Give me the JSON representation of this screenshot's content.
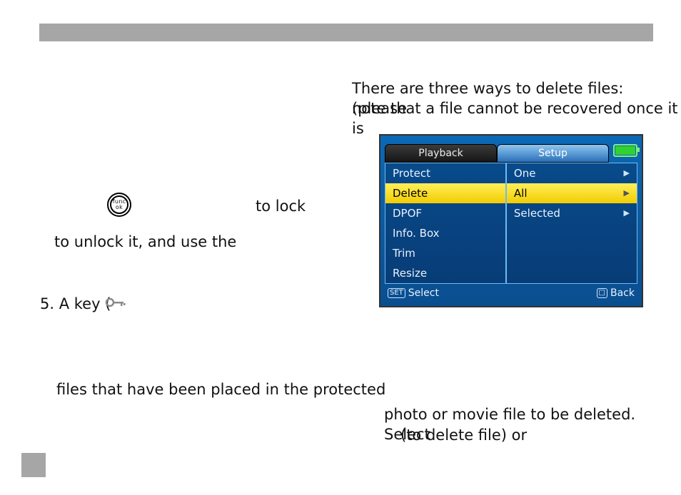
{
  "left": {
    "to_lock": "to lock",
    "to_unlock": "to unlock it, and use the",
    "step5_prefix": "5. A key (",
    "protected_line": "files that have been placed in the protected",
    "func_top": "func",
    "func_bot": "ok"
  },
  "right": {
    "intro_l1": "There are three ways to delete files: (please",
    "intro_l2": "note that a file cannot be recovered once it is",
    "caption_l1": "photo or movie file to be deleted.  Select",
    "caption_l2": "(to delete file) or"
  },
  "lcd": {
    "tabs": {
      "playback": "Playback",
      "setup": "Setup"
    },
    "menu_left": [
      "Protect",
      "Delete",
      "DPOF",
      "Info. Box",
      "Trim",
      "Resize"
    ],
    "menu_left_selected": "Delete",
    "menu_right": [
      "One",
      "All",
      "Selected"
    ],
    "menu_right_selected": "All",
    "footer_select_chip": "SET",
    "footer_select": "Select",
    "footer_back_chip": "□",
    "footer_back": "Back"
  }
}
